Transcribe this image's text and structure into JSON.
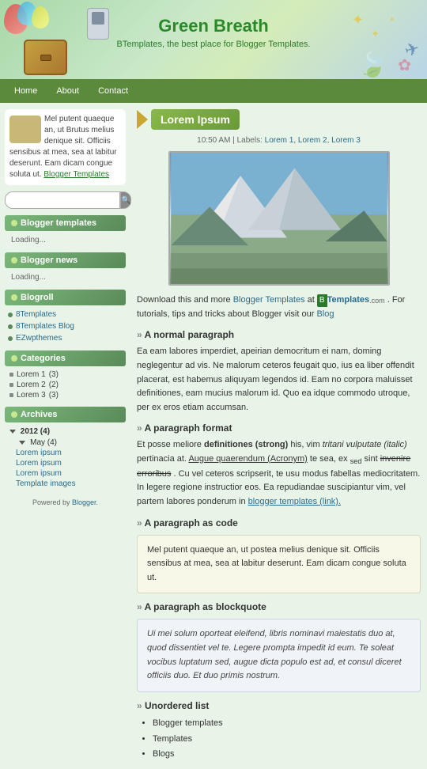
{
  "site": {
    "title": "Green Breath",
    "subtitle": "BTemplates, the best place for Blogger Templates.",
    "logo_bg": "#c8e8a8"
  },
  "nav": {
    "items": [
      "Home",
      "About",
      "Contact"
    ]
  },
  "sidebar": {
    "welcome_text": "Mel putent quaeque an, ut Brutus melius denique sit. Officiis sensibus at mea, sea at labitur deserunt. Eam dicam congue soluta ut.",
    "welcome_link_text": "Blogger Templates",
    "search_placeholder": "",
    "sections": {
      "blogger_templates": {
        "title": "Blogger templates",
        "loading": "Loading..."
      },
      "blogger_news": {
        "title": "Blogger news",
        "loading": "Loading..."
      },
      "blogroll": {
        "title": "Blogroll",
        "items": [
          "8Templates",
          "8Templates Blog",
          "EZwpthemes"
        ]
      },
      "categories": {
        "title": "Categories",
        "items": [
          {
            "label": "Lorem 1",
            "count": "(3)"
          },
          {
            "label": "Lorem 2",
            "count": "(2)"
          },
          {
            "label": "Lorem 3",
            "count": "(3)"
          }
        ]
      },
      "archives": {
        "title": "Archives",
        "years": [
          {
            "label": "2012 (4)",
            "expanded": true,
            "months": [
              {
                "label": "May (4)",
                "expanded": true,
                "posts": [
                  "Lorem ipsum",
                  "Lorem ipsum",
                  "Lorem ipsum",
                  "Template images"
                ]
              }
            ]
          }
        ]
      }
    },
    "powered_by": "Powered by Blogger."
  },
  "post": {
    "title": "Lorem Ipsum",
    "time": "10:50 AM",
    "labels_prefix": "Labels:",
    "labels": [
      "Lorem 1",
      "Lorem 2",
      "Lorem 3"
    ],
    "download_text": "Download this and more",
    "download_link": "Blogger Templates",
    "download_at": "at",
    "btemplates_text": "Templates",
    "btemplates_com": ".com",
    "btemplates_b": "B",
    "for_tutorials": ". For tutorials, tips and tricks about Blogger visit our",
    "blog_link": "Blog",
    "sections": [
      {
        "heading": "A normal paragraph",
        "content": "Ea eam labores imperdiet, apeirian democritum ei nam, doming neglegentur ad vis. Ne malorum ceteros feugait quo, ius ea liber offendit placerat, est habemus aliquyam legendos id. Eam no corpora maluisset definitiones, eam mucius malorum id. Quo ea idque commodo utroque, per ex eros etiam accumsan."
      },
      {
        "heading": "A paragraph format",
        "content_parts": [
          {
            "text": "Et posse meliore ",
            "style": "normal"
          },
          {
            "text": "definitiones (strong)",
            "style": "strong"
          },
          {
            "text": " his, vim ",
            "style": "normal"
          },
          {
            "text": "tritani vulputate (italic)",
            "style": "italic"
          },
          {
            "text": " pertinacia at. ",
            "style": "normal"
          },
          {
            "text": "Augue quaerendum (Acronym)",
            "style": "underline"
          },
          {
            "text": " te sea, ex ",
            "style": "normal"
          },
          {
            "text": "sed",
            "style": "small"
          },
          {
            "text": " sint ",
            "style": "normal"
          },
          {
            "text": "invenire erroribus",
            "style": "strikethrough"
          },
          {
            "text": ". Cu vel ceteros scripserit, te usu modus fabellas mediocritatem. In legere regione instructior eos. Ea repudiandae suscipiantur vim, vel partem labores ponderum in ",
            "style": "normal"
          },
          {
            "text": "blogger templates (link).",
            "style": "link"
          }
        ]
      },
      {
        "heading": "A paragraph as code",
        "code": "Mel putent quaeque an, ut postea melius denique sit. Officiis sensibus at mea, sea at labitur deserunt. Eam dicam congue soluta ut."
      },
      {
        "heading": "A paragraph as blockquote",
        "blockquote": "Ui mei solum oporteat eleifend, libris nominavi maiestatis duo at, quod dissentiet vel te. Legere prompta impedit id eum. Te soleat vocibus luptatum sed, augue dicta populo est ad, et consul diceret officiis duo. Et duo primis nostrum."
      },
      {
        "heading": "Unordered list",
        "list_items": [
          "Blogger templates",
          "Templates",
          "Blogs"
        ]
      }
    ]
  }
}
